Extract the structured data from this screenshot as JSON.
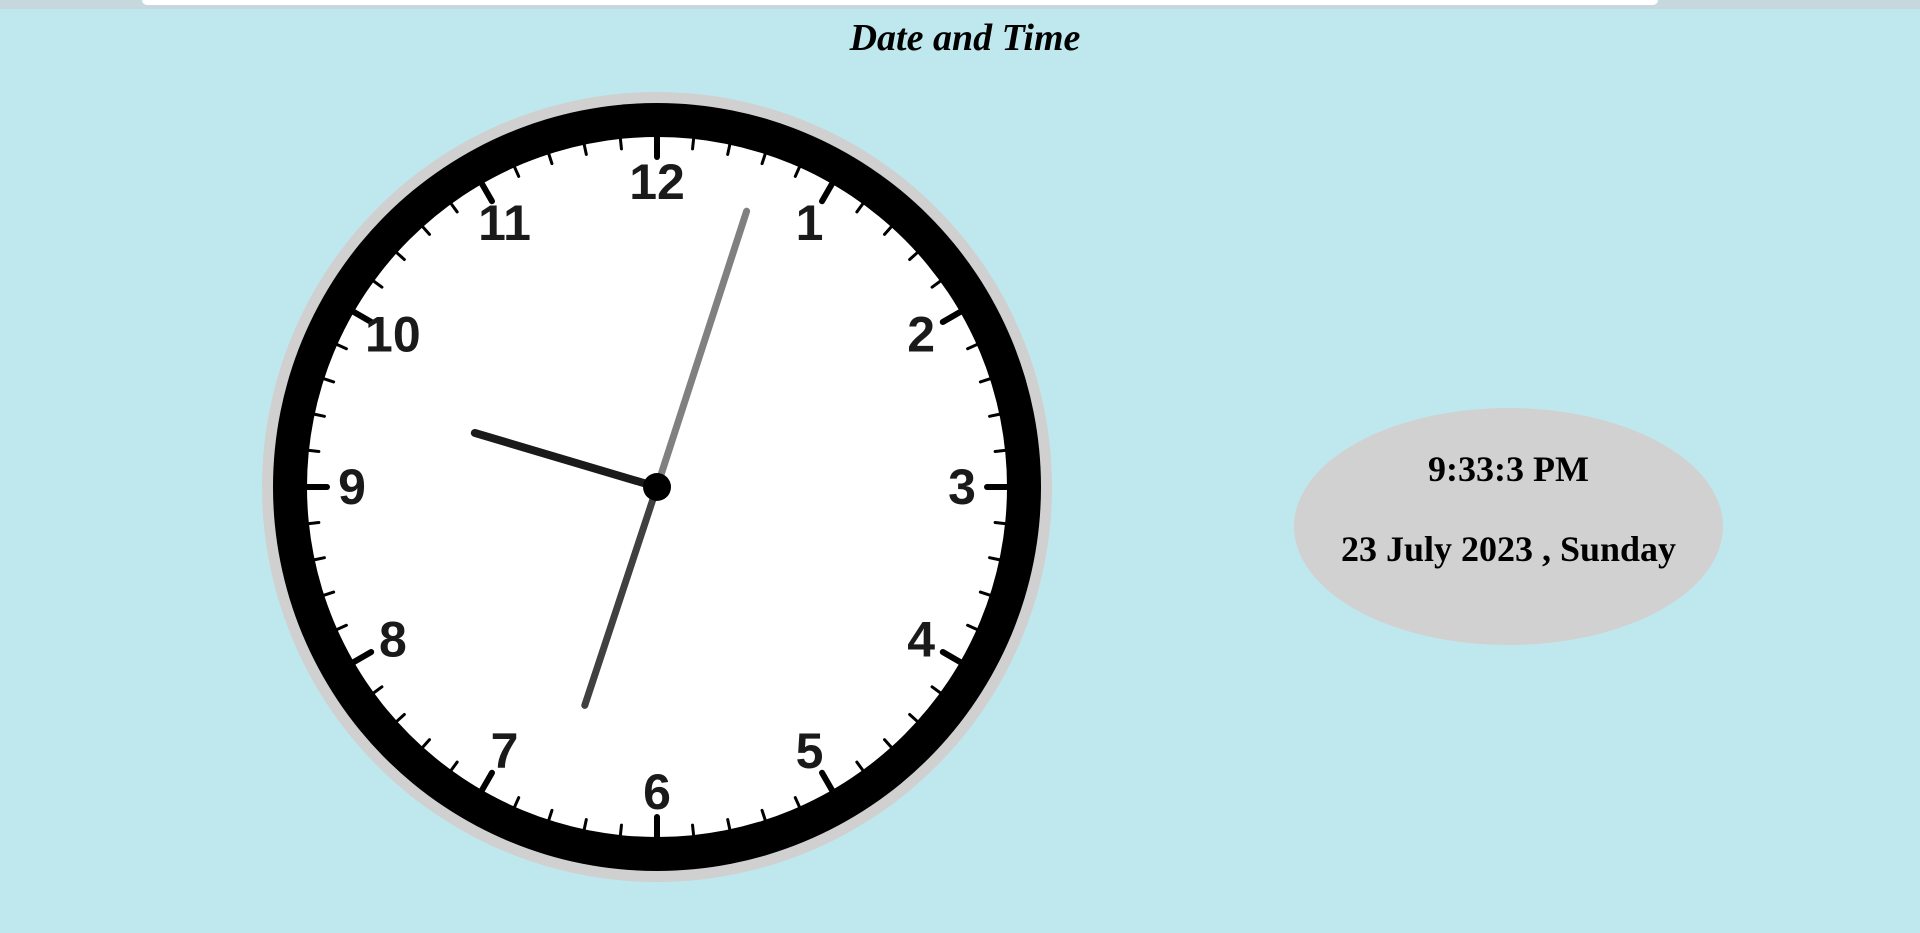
{
  "page": {
    "title": "Date and Time",
    "background_color": "#bfe8ee"
  },
  "analog_clock": {
    "numerals": [
      "12",
      "1",
      "2",
      "3",
      "4",
      "5",
      "6",
      "7",
      "8",
      "9",
      "10",
      "11"
    ],
    "time": {
      "hours": 9,
      "minutes": 33,
      "seconds": 3
    },
    "colors": {
      "outer_ring": "#d0d0d0",
      "bezel": "#000000",
      "face": "#ffffff",
      "hour_hand": "#1a1a1a",
      "minute_hand": "#404040",
      "second_hand": "#808080"
    }
  },
  "digital_display": {
    "time": "9:33:3 PM",
    "date": "23 July 2023 , Sunday",
    "background_color": "#d1d1d1"
  }
}
